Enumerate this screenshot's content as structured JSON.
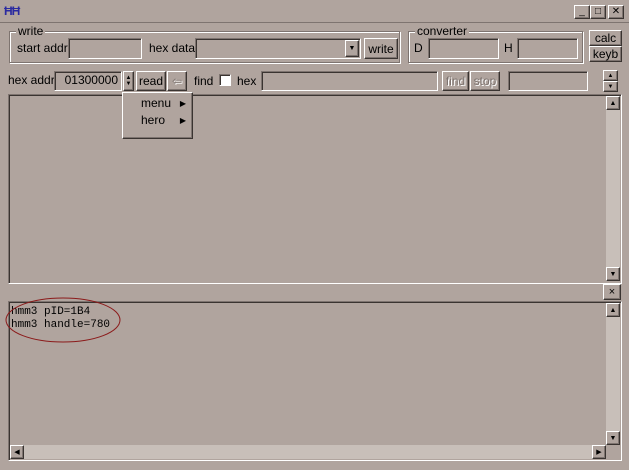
{
  "window": {
    "title": "",
    "icon": "app-logo-icon",
    "minimize_glyph": "_",
    "maximize_glyph": "□",
    "close_glyph": "✕"
  },
  "write_group": {
    "title": "write",
    "start_addr_label": "start addr",
    "start_addr_value": "",
    "hex_data_label": "hex data",
    "hex_data_value": "",
    "write_button": "write"
  },
  "converter_group": {
    "title": "converter",
    "d_label": "D",
    "d_value": "",
    "h_label": "H",
    "h_value": ""
  },
  "side_buttons": {
    "calc": "calc",
    "keyb": "keyb"
  },
  "read_row": {
    "hex_addr_label": "hex addr",
    "hex_addr_value": "01300000",
    "read_button": "read",
    "back_glyph": "⇦",
    "find_label": "find",
    "hex_label": "hex",
    "find_value": "",
    "find_button": "find",
    "stop_button": "stop",
    "status_value": ""
  },
  "popup_menu": {
    "items": [
      {
        "label": "menu",
        "arrow": "▶"
      },
      {
        "label": "hero",
        "arrow": "▶"
      }
    ]
  },
  "console": {
    "lines": [
      "hmm3 pID=1B4",
      "hmm3 handle=780"
    ],
    "highlight_color": "#8b1a1a",
    "close_glyph": "×"
  },
  "colors": {
    "face": "#b0a49e",
    "shadow": "#7e7470",
    "dark": "#3a3431",
    "icon": "#2a2aa0"
  }
}
